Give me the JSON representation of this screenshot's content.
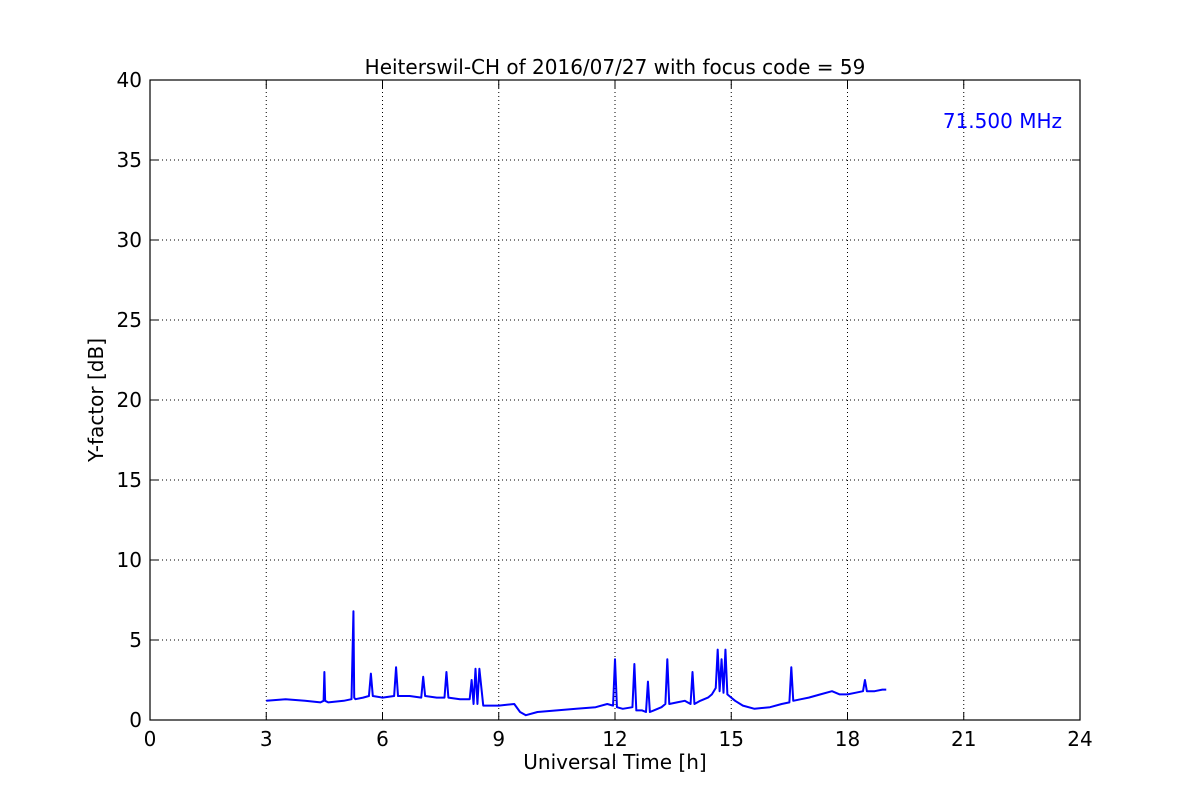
{
  "chart_data": {
    "type": "line",
    "title": "Heiterswil-CH of 2016/07/27 with focus code = 59",
    "xlabel": "Universal Time [h]",
    "ylabel": "Y-factor [dB]",
    "xlim": [
      0,
      24
    ],
    "ylim": [
      0,
      40
    ],
    "xticks": [
      0,
      3,
      6,
      9,
      12,
      15,
      18,
      21,
      24
    ],
    "yticks": [
      0,
      5,
      10,
      15,
      20,
      25,
      30,
      35,
      40
    ],
    "grid": true,
    "annotation": "71.500 MHz",
    "series": [
      {
        "color": "#0000ff",
        "x": [
          3.0,
          3.5,
          4.0,
          4.4,
          4.48,
          4.5,
          4.52,
          4.6,
          5.0,
          5.2,
          5.25,
          5.27,
          5.3,
          5.5,
          5.65,
          5.7,
          5.75,
          6.0,
          6.3,
          6.35,
          6.4,
          6.7,
          7.0,
          7.05,
          7.1,
          7.4,
          7.6,
          7.65,
          7.7,
          8.0,
          8.25,
          8.3,
          8.35,
          8.4,
          8.45,
          8.5,
          8.6,
          9.0,
          9.4,
          9.55,
          9.7,
          10.0,
          10.5,
          11.0,
          11.5,
          11.8,
          11.95,
          12.0,
          12.05,
          12.2,
          12.45,
          12.5,
          12.55,
          12.7,
          12.8,
          12.85,
          12.9,
          13.0,
          13.2,
          13.3,
          13.35,
          13.4,
          13.6,
          13.8,
          13.95,
          14.0,
          14.05,
          14.2,
          14.4,
          14.5,
          14.6,
          14.65,
          14.7,
          14.75,
          14.8,
          14.85,
          14.9,
          15.0,
          15.1,
          15.3,
          15.6,
          16.0,
          16.3,
          16.5,
          16.55,
          16.6,
          16.8,
          17.0,
          17.3,
          17.6,
          17.8,
          18.0,
          18.2,
          18.4,
          18.45,
          18.5,
          18.7,
          18.9,
          19.0
        ],
        "values": [
          1.2,
          1.3,
          1.2,
          1.1,
          1.2,
          3.0,
          1.2,
          1.1,
          1.2,
          1.3,
          6.8,
          1.4,
          1.3,
          1.4,
          1.5,
          2.9,
          1.5,
          1.4,
          1.5,
          3.3,
          1.5,
          1.5,
          1.4,
          2.7,
          1.5,
          1.4,
          1.4,
          3.0,
          1.4,
          1.3,
          1.3,
          2.5,
          1.0,
          3.2,
          1.0,
          3.2,
          0.9,
          0.9,
          1.0,
          0.5,
          0.3,
          0.5,
          0.6,
          0.7,
          0.8,
          1.0,
          0.9,
          3.8,
          0.8,
          0.7,
          0.8,
          3.5,
          0.6,
          0.6,
          0.5,
          2.4,
          0.5,
          0.6,
          0.8,
          1.0,
          3.8,
          1.0,
          1.1,
          1.2,
          1.0,
          3.0,
          1.0,
          1.2,
          1.4,
          1.6,
          2.0,
          4.4,
          1.8,
          3.8,
          1.7,
          4.4,
          1.6,
          1.4,
          1.2,
          0.9,
          0.7,
          0.8,
          1.0,
          1.1,
          3.3,
          1.2,
          1.3,
          1.4,
          1.6,
          1.8,
          1.6,
          1.6,
          1.7,
          1.8,
          2.5,
          1.8,
          1.8,
          1.9,
          1.9
        ]
      }
    ]
  }
}
